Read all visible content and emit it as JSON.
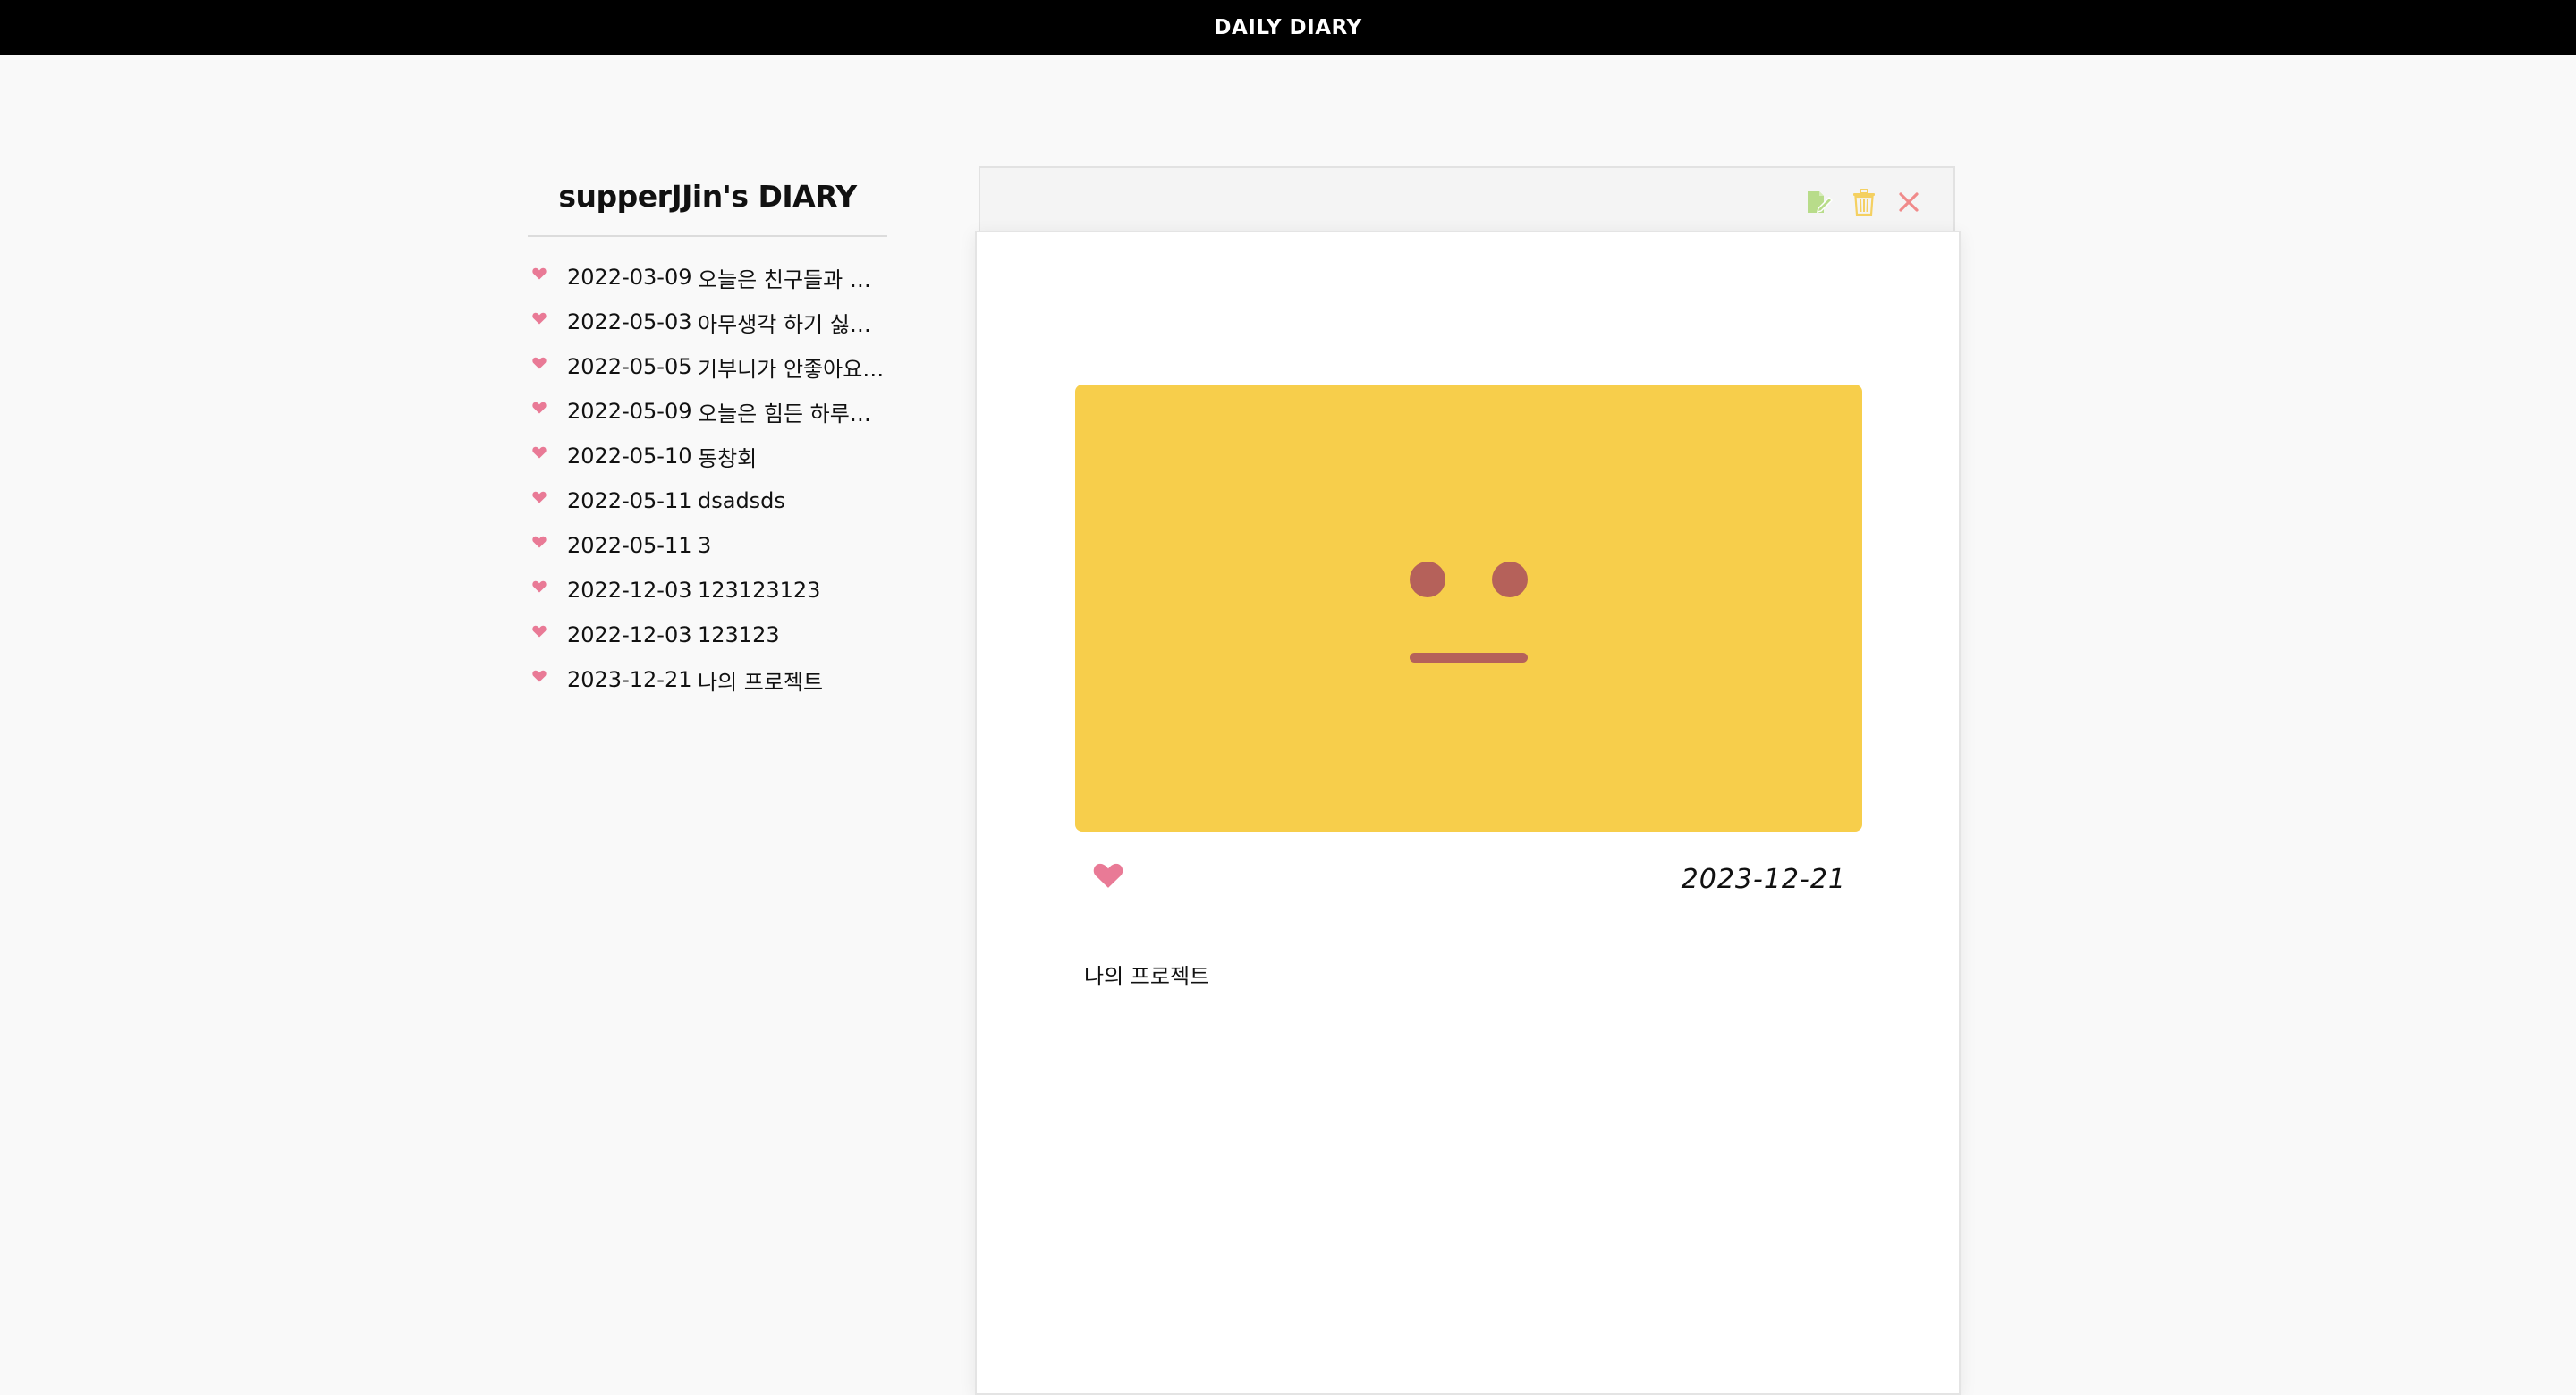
{
  "header": {
    "title": "DAILY DIARY"
  },
  "sidebar": {
    "title": "supperJJin's DIARY",
    "entries": [
      {
        "date": "2022-03-09",
        "title": "오늘은 친구들과 함께"
      },
      {
        "date": "2022-05-03",
        "title": "아무생각 하기 싫어…"
      },
      {
        "date": "2022-05-05",
        "title": "기부니가 안좋아요 …"
      },
      {
        "date": "2022-05-09",
        "title": "오늘은 힘든 하루였…"
      },
      {
        "date": "2022-05-10",
        "title": "동창회"
      },
      {
        "date": "2022-05-11",
        "title": "dsadsds"
      },
      {
        "date": "2022-05-11",
        "title": "3"
      },
      {
        "date": "2022-12-03",
        "title": "123123123"
      },
      {
        "date": "2022-12-03",
        "title": "123123"
      },
      {
        "date": "2023-12-21",
        "title": "나의 프로젝트"
      }
    ]
  },
  "detail": {
    "actions": [
      {
        "name": "edit-icon",
        "color": "#b8dc8a"
      },
      {
        "name": "trash-icon",
        "color": "#f4d061"
      },
      {
        "name": "close-icon",
        "color": "#f08a8a"
      }
    ],
    "mood": {
      "panel_color": "#f7ce4b",
      "feature_color": "#b5615a",
      "icon": "neutral-face-icon"
    },
    "liked": true,
    "heart_color": "#e97a96",
    "date": "2023-12-21",
    "content": "나의 프로젝트"
  }
}
